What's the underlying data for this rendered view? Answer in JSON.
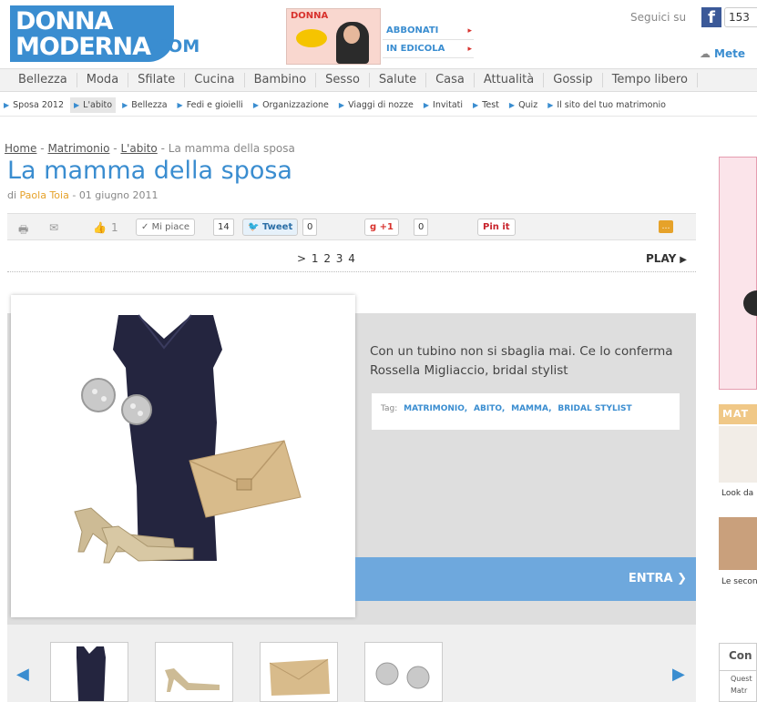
{
  "header": {
    "logo_line1": "DONNA",
    "logo_line2": "MODERNA",
    "logo_suffix": ".COM",
    "magazine_title": "DONNA",
    "subscribe": "ABBONATI",
    "newsstand": "IN EDICOLA",
    "follow_label": "Seguici su",
    "facebook_icon": "f",
    "facebook_count": "153",
    "weather_label": "Mete"
  },
  "nav": {
    "items": [
      "Bellezza",
      "Moda",
      "Sfilate",
      "Cucina",
      "Bambino",
      "Sesso",
      "Salute",
      "Casa",
      "Attualità",
      "Gossip",
      "Tempo libero"
    ]
  },
  "subnav": {
    "items": [
      "Sposa 2012",
      "L'abito",
      "Bellezza",
      "Fedi e gioielli",
      "Organizzazione",
      "Viaggi di nozze",
      "Invitati",
      "Test",
      "Quiz",
      "Il sito del tuo matrimonio"
    ],
    "active_index": 1
  },
  "breadcrumb": {
    "home": "Home",
    "section": "Matrimonio",
    "subsection": "L'abito",
    "current": "La mamma della sposa",
    "sep": "-"
  },
  "article": {
    "title": "La mamma della sposa",
    "by": "di",
    "author": "Paola Toia",
    "date": "01 giugno 2011",
    "date_sep": "-"
  },
  "share": {
    "like_count": "1",
    "fb_like": "Mi piace",
    "fb_count": "14",
    "tweet": "Tweet",
    "tweet_count": "0",
    "gplus": "+1",
    "gplus_count": "0",
    "pinit": "Pin it"
  },
  "pager": {
    "prev": ">",
    "pages": "1 2 3 4",
    "play": "PLAY"
  },
  "gallery": {
    "caption": "Con un tubino non si sbaglia mai. Ce lo conferma Rossella Migliaccio, bridal stylist",
    "tags_label": "Tag:",
    "tags": [
      "MATRIMONIO,",
      "ABITO,",
      "MAMMA,",
      "BRIDAL STYLIST"
    ],
    "enter": "ENTRA"
  },
  "sidebar": {
    "section_header": "MAT",
    "item1": "Look da",
    "item2": "Le secon",
    "box_title": "Con",
    "box_line1": "Quest",
    "box_line2": "Matr"
  },
  "colors": {
    "brand_blue": "#3a8dd0",
    "accent_orange": "#e6a22a",
    "entra_blue": "#6ea8dd"
  }
}
